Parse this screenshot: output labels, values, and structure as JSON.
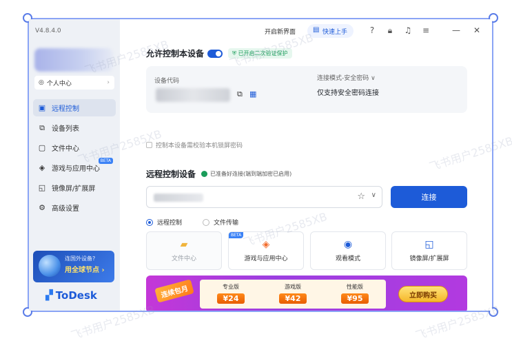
{
  "app": {
    "version": "V4.8.4.0",
    "logo_text": "ToDesk"
  },
  "sidebar": {
    "personal_center": "个人中心",
    "items": [
      {
        "label": "远程控制",
        "icon": "monitor-icon",
        "active": true
      },
      {
        "label": "设备列表",
        "icon": "device-list-icon"
      },
      {
        "label": "文件中心",
        "icon": "folder-icon"
      },
      {
        "label": "游戏与应用中心",
        "icon": "gamepad-icon",
        "badge": "BETA"
      },
      {
        "label": "镜像屏/扩展屏",
        "icon": "cast-icon"
      },
      {
        "label": "高级设置",
        "icon": "gear-icon"
      }
    ],
    "promo": {
      "line1": "连国外设备?",
      "line2": "用全球节点 ›"
    }
  },
  "titlebar": {
    "new_ui": "开启新界面",
    "quick_start": "快速上手"
  },
  "allow_control": {
    "title": "允许控制本设备",
    "badge": "已开启二次验证保护",
    "device_code_label": "设备代码",
    "mode_label": "连接模式-安全密码 ∨",
    "mode_value": "仅支持安全密码连接",
    "lock_screen_checkbox": "控制本设备需校验本机锁屏密码"
  },
  "remote_control": {
    "title": "远程控制设备",
    "status": "已准备好连接(端到端加密已启用)",
    "connect_button": "连接",
    "radio_remote": "远程控制",
    "radio_file": "文件传输",
    "tiles": [
      {
        "label": "文件中心",
        "icon": "folder-icon"
      },
      {
        "label": "游戏与应用中心",
        "icon": "gamepad-icon",
        "badge": "BETA"
      },
      {
        "label": "观看模式",
        "icon": "eye-icon"
      },
      {
        "label": "镜像屏/扩展屏",
        "icon": "cast-icon"
      }
    ]
  },
  "banner": {
    "ribbon": "连续包月",
    "tiers": [
      {
        "name": "专业版",
        "price": "¥24"
      },
      {
        "name": "游戏版",
        "price": "¥42"
      },
      {
        "name": "性能版",
        "price": "¥95"
      }
    ],
    "buy_button": "立即购买"
  },
  "watermark": "飞书用户2585XB"
}
